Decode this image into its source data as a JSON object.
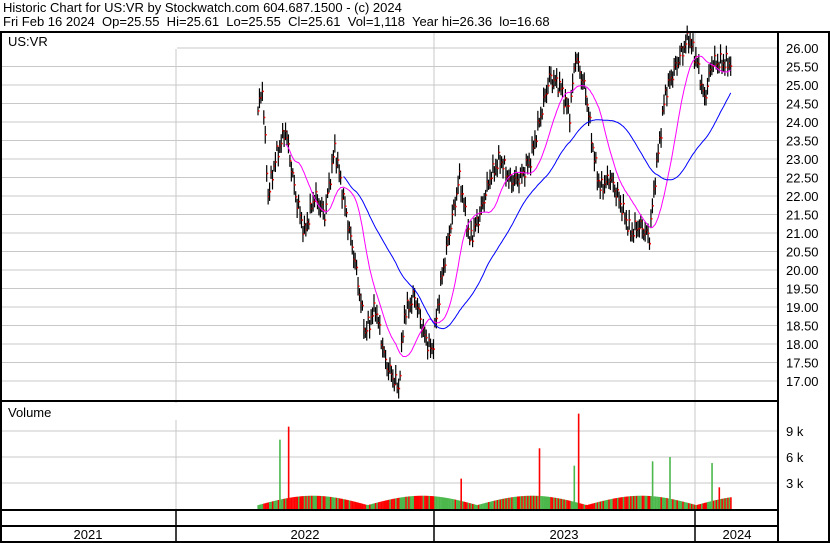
{
  "header": {
    "title": "Historic Chart for US:VR by Stockwatch.com 604.687.1500 - (c) 2024",
    "quote": "Fri Feb 16 2024  Op=25.55  Hi=25.61  Lo=25.55  Cl=25.61  Vol=1,118  Year hi=26.36  lo=16.68"
  },
  "chart_data": {
    "type": "line",
    "symbol": "US:VR",
    "volume_label": "Volume",
    "ylim": [
      16.5,
      26.4
    ],
    "yticks": [
      "26.00",
      "25.50",
      "25.00",
      "24.50",
      "24.00",
      "23.50",
      "23.00",
      "22.50",
      "22.00",
      "21.50",
      "21.00",
      "20.50",
      "20.00",
      "19.50",
      "19.00",
      "18.50",
      "18.00",
      "17.50",
      "17.00"
    ],
    "volume_ticks": [
      {
        "label": "9 k",
        "value": 9000
      },
      {
        "label": "6 k",
        "value": 6000
      },
      {
        "label": "3 k",
        "value": 3000
      }
    ],
    "years": [
      "2021",
      "2022",
      "2023",
      "2024"
    ],
    "price_keypoints": [
      [
        0,
        24.3
      ],
      [
        3,
        24.9
      ],
      [
        7,
        22.0
      ],
      [
        12,
        23.0
      ],
      [
        19,
        23.8
      ],
      [
        26,
        22.0
      ],
      [
        32,
        21.0
      ],
      [
        39,
        22.0
      ],
      [
        46,
        21.5
      ],
      [
        53,
        23.3
      ],
      [
        60,
        21.7
      ],
      [
        67,
        20.2
      ],
      [
        74,
        18.3
      ],
      [
        81,
        19.0
      ],
      [
        88,
        17.5
      ],
      [
        97,
        16.8
      ],
      [
        101,
        18.8
      ],
      [
        108,
        19.3
      ],
      [
        115,
        18.2
      ],
      [
        120,
        17.8
      ],
      [
        126,
        19.6
      ],
      [
        132,
        21.0
      ],
      [
        139,
        22.5
      ],
      [
        146,
        20.8
      ],
      [
        153,
        21.5
      ],
      [
        160,
        22.5
      ],
      [
        167,
        23.0
      ],
      [
        174,
        22.4
      ],
      [
        181,
        22.5
      ],
      [
        188,
        23.0
      ],
      [
        194,
        24.0
      ],
      [
        201,
        25.2
      ],
      [
        208,
        25.0
      ],
      [
        215,
        24.2
      ],
      [
        219,
        25.8
      ],
      [
        226,
        24.8
      ],
      [
        232,
        23.0
      ],
      [
        236,
        22.2
      ],
      [
        243,
        22.5
      ],
      [
        250,
        21.8
      ],
      [
        257,
        21.0
      ],
      [
        263,
        21.2
      ],
      [
        270,
        20.9
      ],
      [
        274,
        22.5
      ],
      [
        281,
        24.8
      ],
      [
        288,
        25.5
      ],
      [
        297,
        26.3
      ],
      [
        303,
        25.6
      ],
      [
        308,
        24.6
      ],
      [
        313,
        25.6
      ],
      [
        326,
        25.6
      ]
    ],
    "volume_spikes": [
      [
        15,
        8000
      ],
      [
        21,
        9500
      ],
      [
        140,
        3500
      ],
      [
        194,
        7000
      ],
      [
        218,
        5000
      ],
      [
        221,
        11000
      ],
      [
        272,
        5500
      ],
      [
        284,
        6000
      ],
      [
        313,
        5300
      ],
      [
        318,
        2500
      ]
    ],
    "volume_baseline": 900,
    "moving_averages": [
      {
        "name": "short MA",
        "period": 20,
        "color": "#ff00ff"
      },
      {
        "name": "long MA",
        "period": 60,
        "color": "#0000ff"
      }
    ],
    "colors": {
      "bar": "#000000",
      "close": "#ff0000",
      "vol_up": "#4cb84c",
      "vol_down": "#ff0000",
      "grid": "#c8c8c8"
    }
  }
}
